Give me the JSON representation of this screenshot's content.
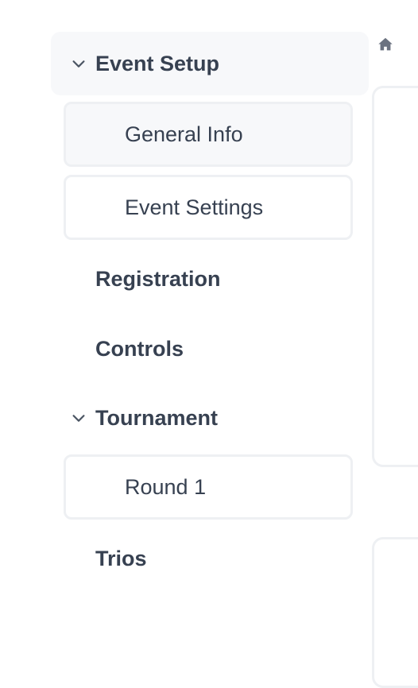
{
  "sidebar": {
    "event_setup": {
      "label": "Event Setup",
      "expanded": true,
      "items": [
        {
          "label": "General Info"
        },
        {
          "label": "Event Settings"
        }
      ]
    },
    "registration": {
      "label": "Registration"
    },
    "controls": {
      "label": "Controls"
    },
    "tournament": {
      "label": "Tournament",
      "expanded": true,
      "items": [
        {
          "label": "Round 1"
        }
      ]
    },
    "trios": {
      "label": "Trios"
    }
  },
  "icons": {
    "home": "home-icon",
    "chevron": "chevron-down-icon"
  },
  "colors": {
    "text": "#374151",
    "active_bg": "#f7f8fa",
    "border": "#eef0f3",
    "icon": "#6b7280"
  }
}
